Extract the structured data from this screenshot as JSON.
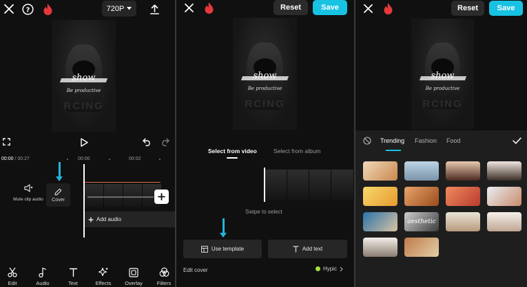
{
  "colors": {
    "accent": "#18c2e3",
    "fire": "#e5383b",
    "panel_bg": "#101010",
    "arrow": "#22b5dc"
  },
  "editor": {
    "resolution": "720P",
    "time_current": "00:00",
    "time_total": "00:27",
    "ruler_marks": [
      "00:00",
      "00:02"
    ],
    "mute_label": "Mute clip audio",
    "cover_label": "Cover",
    "add_audio_label": "Add audio",
    "video_caption": "show",
    "video_subcaption": "Be productive",
    "video_ghost_text": "RCING",
    "toolbar": [
      {
        "label": "Edit",
        "icon": "scissors-icon"
      },
      {
        "label": "Audio",
        "icon": "music-note-icon"
      },
      {
        "label": "Text",
        "icon": "text-icon"
      },
      {
        "label": "Effects",
        "icon": "sparkle-icon"
      },
      {
        "label": "Overlay",
        "icon": "overlay-icon"
      },
      {
        "label": "Filters",
        "icon": "filters-icon"
      }
    ]
  },
  "cover": {
    "reset_label": "Reset",
    "save_label": "Save",
    "tab_video": "Select from video",
    "tab_album": "Select from album",
    "swipe_hint": "Swipe to select",
    "use_template_label": "Use template",
    "add_text_label": "Add text",
    "edit_cover_label": "Edit cover",
    "hypic_label": "Hypic"
  },
  "templates": {
    "reset_label": "Reset",
    "save_label": "Save",
    "tabs": [
      "Trending",
      "Fashion",
      "Food"
    ],
    "active_tab": "Trending",
    "thumbnail_texts": [
      "",
      "",
      "",
      "",
      "",
      "",
      "",
      "",
      "",
      "aesthetic",
      "",
      "",
      "",
      ""
    ]
  }
}
